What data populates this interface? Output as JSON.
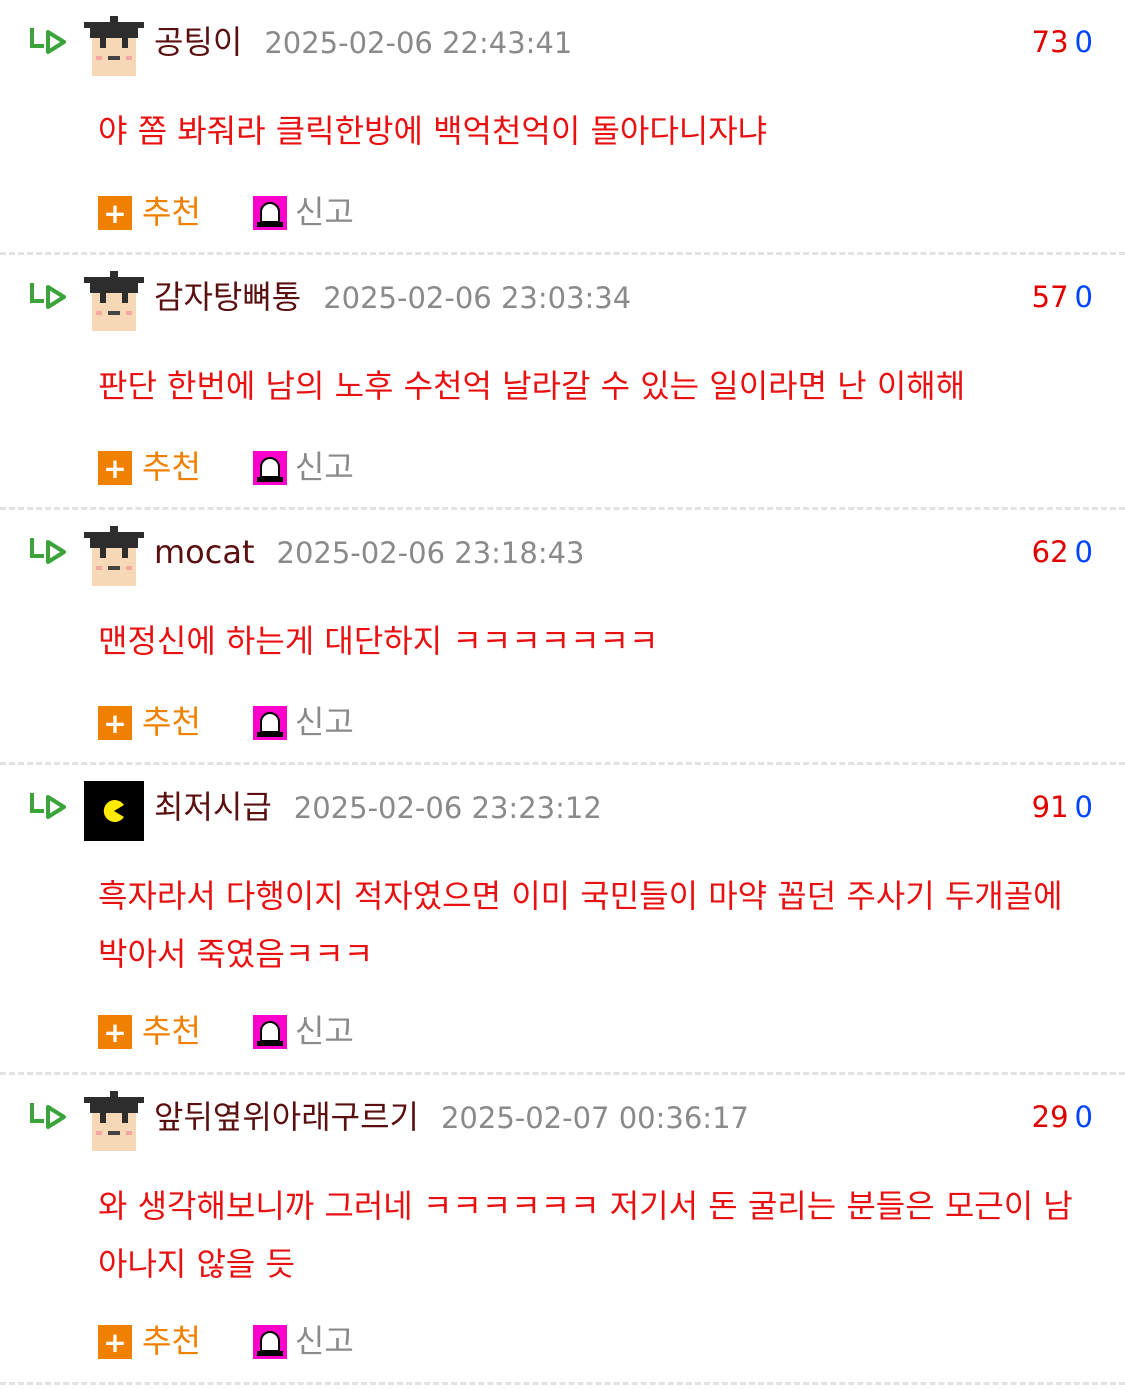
{
  "actions": {
    "recommend_label": "추천",
    "report_label": "신고"
  },
  "comments": [
    {
      "author": "공팅이",
      "date": "2025-02-06 22:43:41",
      "up": "73",
      "down": "0",
      "avatar": "graduate-avatar",
      "text": "야 쫌 봐줘라 클릭한방에 백억천억이 돌아다니자냐"
    },
    {
      "author": "감자탕뼈통",
      "date": "2025-02-06 23:03:34",
      "up": "57",
      "down": "0",
      "avatar": "graduate-avatar",
      "text": "판단 한번에 남의 노후 수천억 날라갈 수 있는 일이라면 난 이해해"
    },
    {
      "author": "mocat",
      "date": "2025-02-06 23:18:43",
      "up": "62",
      "down": "0",
      "avatar": "graduate-avatar",
      "text": "맨정신에 하는게 대단하지 ㅋㅋㅋㅋㅋㅋㅋ"
    },
    {
      "author": "최저시급",
      "date": "2025-02-06 23:23:12",
      "up": "91",
      "down": "0",
      "avatar": "pacman-avatar",
      "text": "흑자라서 다행이지 적자였으면 이미 국민들이 마약 꼽던 주사기 두개골에 박아서 죽였음ㅋㅋㅋ"
    },
    {
      "author": "앞뒤옆위아래구르기",
      "date": "2025-02-07 00:36:17",
      "up": "29",
      "down": "0",
      "avatar": "graduate-avatar",
      "text": "와 생각해보니까 그러네 ㅋㅋㅋㅋㅋㅋ 저기서 돈 굴리는 분들은 모근이 남아나지 않을 듯"
    }
  ]
}
